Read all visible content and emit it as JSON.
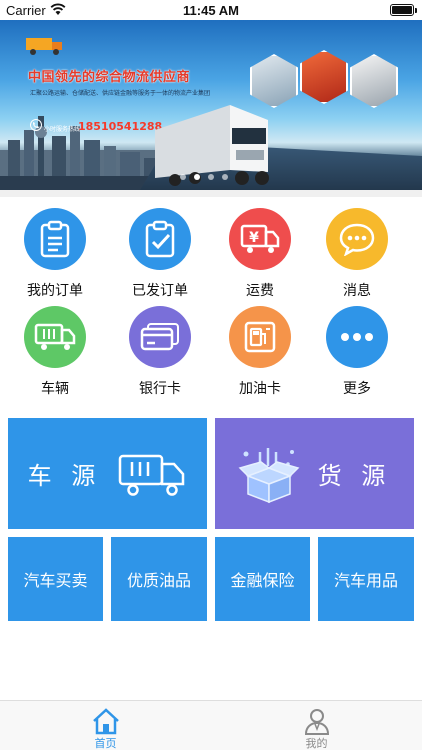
{
  "status_bar": {
    "carrier": "Carrier",
    "time": "11:45 AM"
  },
  "banner": {
    "headline": "中国领先的综合物流供应商",
    "subline": "汇聚公路运输、仓储配送、供应链金融等服务于一体的物流产业集团",
    "hotline_label": "小时服务热线",
    "phone": "18510541288",
    "slide_count": 4,
    "active_slide": 2
  },
  "grid": {
    "items": [
      {
        "label": "我的订单",
        "icon": "clipboard-icon",
        "color": "#2f95e8"
      },
      {
        "label": "已发订单",
        "icon": "clipboard-check-icon",
        "color": "#2f95e8"
      },
      {
        "label": "运费",
        "icon": "yen-truck-icon",
        "color": "#ef4d4d"
      },
      {
        "label": "消息",
        "icon": "chat-bubble-icon",
        "color": "#f7b92c"
      },
      {
        "label": "车辆",
        "icon": "truck-icon",
        "color": "#5ec866"
      },
      {
        "label": "银行卡",
        "icon": "bank-card-icon",
        "color": "#7a6fd9"
      },
      {
        "label": "加油卡",
        "icon": "fuel-card-icon",
        "color": "#f5944a"
      },
      {
        "label": "更多",
        "icon": "more-icon",
        "color": "#2f95e8"
      }
    ]
  },
  "tiles": {
    "vehicle_source": {
      "label": "车 源",
      "color": "#2f95e8"
    },
    "cargo_source": {
      "label": "货 源",
      "color": "#7a6fd9"
    },
    "small": [
      {
        "label": "汽车买卖"
      },
      {
        "label": "优质油品"
      },
      {
        "label": "金融保险"
      },
      {
        "label": "汽车用品"
      }
    ]
  },
  "tabbar": {
    "tabs": [
      {
        "label": "首页",
        "active": true,
        "color": "#2f95e8"
      },
      {
        "label": "我的",
        "active": false,
        "color": "#8a8a8a"
      }
    ]
  }
}
